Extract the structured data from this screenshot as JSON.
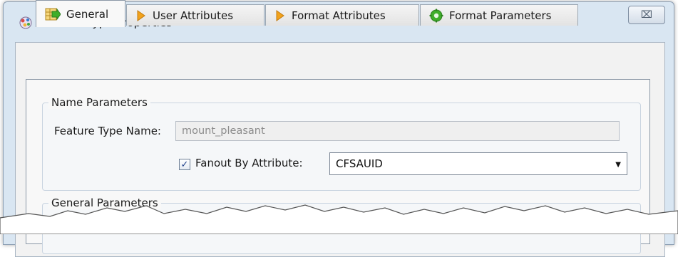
{
  "window": {
    "title": "Feature Type Properties",
    "close_glyph": "⌧"
  },
  "tabs": [
    {
      "label": "General",
      "icon": "arrow-into-table-icon",
      "active": true
    },
    {
      "label": "User Attributes",
      "icon": "orange-arrow-icon",
      "active": false
    },
    {
      "label": "Format Attributes",
      "icon": "orange-arrow-icon",
      "active": false
    },
    {
      "label": "Format Parameters",
      "icon": "green-gear-icon",
      "active": false
    }
  ],
  "name_parameters": {
    "legend": "Name Parameters",
    "feature_type_name_label": "Feature Type Name:",
    "feature_type_name_value": "mount_pleasant",
    "fanout_label": "Fanout By Attribute:",
    "fanout_checked": true,
    "fanout_check_glyph": "✓",
    "fanout_value": "CFSAUID"
  },
  "general_parameters": {
    "legend": "General Parameters"
  },
  "colors": {
    "window_frame": "#d9e6f2",
    "panel": "#f8f8f8",
    "orange_icon": "#f2a21b",
    "green_icon": "#3fae2a"
  }
}
